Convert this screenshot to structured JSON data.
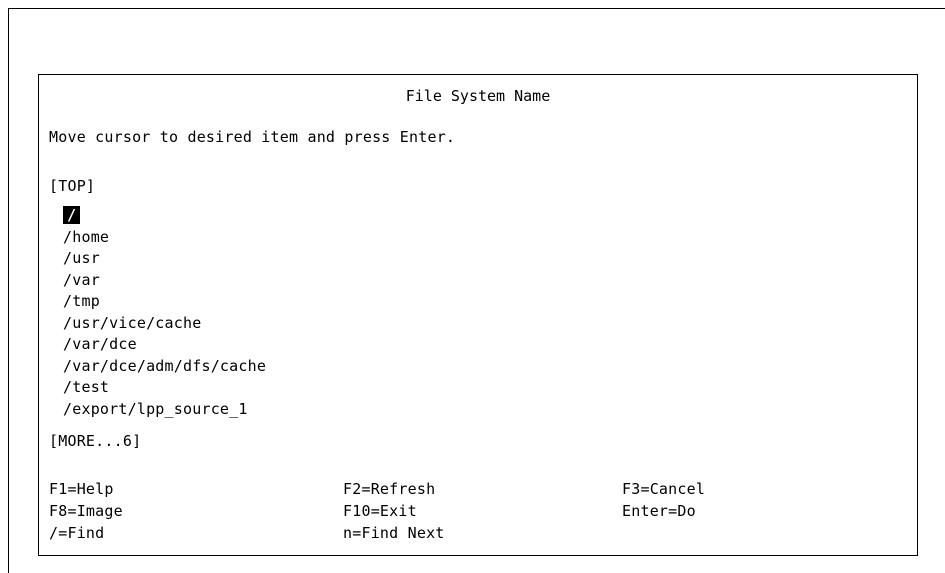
{
  "dialog": {
    "title": "File System Name",
    "instruction": "Move cursor to desired item and press Enter.",
    "top_marker": "[TOP]",
    "more_marker": "[MORE...6]",
    "selected_index": 0,
    "items": [
      "/",
      "/home",
      "/usr",
      "/var",
      "/tmp",
      "/usr/vice/cache",
      "/var/dce",
      "/var/dce/adm/dfs/cache",
      "/test",
      "/export/lpp_source_1"
    ]
  },
  "function_keys": {
    "f1": "F1=Help",
    "f2": "F2=Refresh",
    "f3": "F3=Cancel",
    "f8": "F8=Image",
    "f10": "F10=Exit",
    "enter": "Enter=Do",
    "find": "/=Find",
    "find_next": "n=Find Next"
  }
}
